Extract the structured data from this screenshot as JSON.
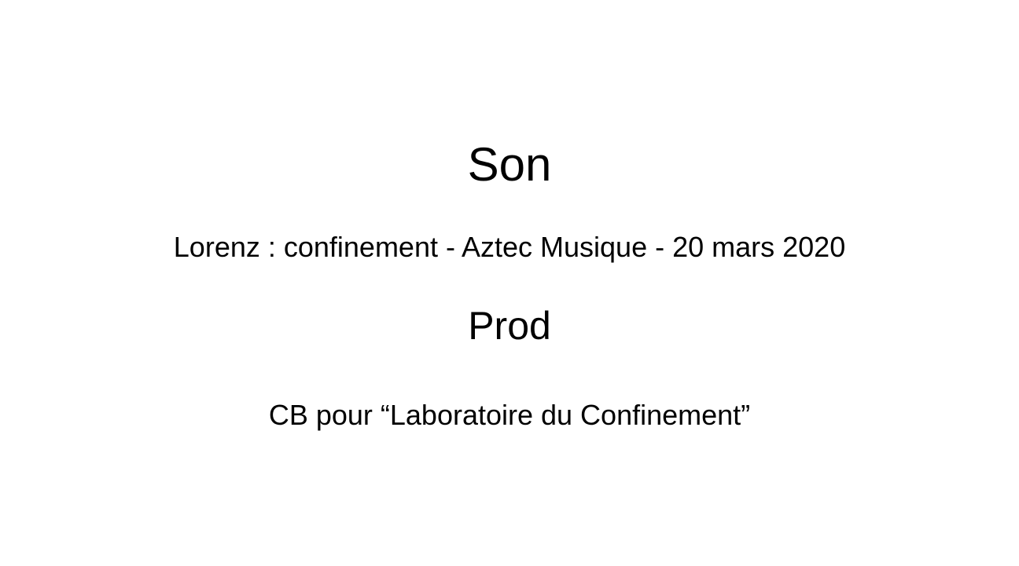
{
  "slide": {
    "heading_sound": "Son",
    "sound_credit": "Lorenz : confinement - Aztec Musique - 20 mars 2020",
    "heading_production": "Prod",
    "production_credit": "CB pour “Laboratoire du Confinement”"
  },
  "colors": {
    "background": "#ffffff",
    "text": "#000000"
  }
}
